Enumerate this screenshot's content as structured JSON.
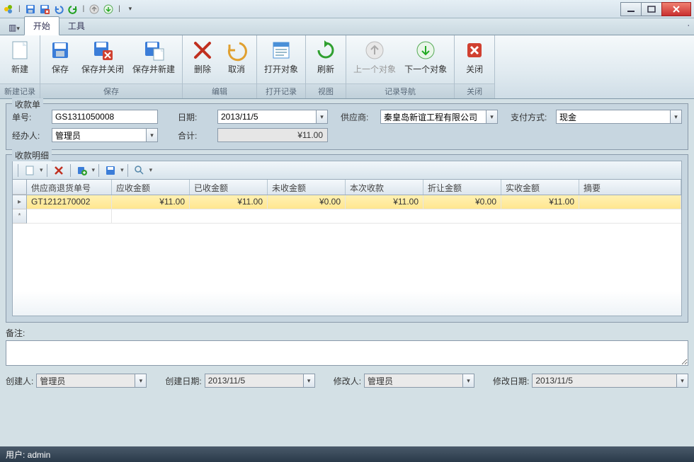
{
  "quick_access": {
    "customize": "▾"
  },
  "tabs": {
    "view_menu": "▾",
    "start": "开始",
    "tools": "工具"
  },
  "ribbon": {
    "new": {
      "label": "新建"
    },
    "save": {
      "label": "保存"
    },
    "save_close": {
      "label": "保存并关闭"
    },
    "save_new": {
      "label": "保存并新建"
    },
    "delete": {
      "label": "删除"
    },
    "cancel": {
      "label": "取消"
    },
    "open_obj": {
      "label": "打开对象"
    },
    "refresh": {
      "label": "刷新"
    },
    "prev_obj": {
      "label": "上一个对象"
    },
    "next_obj": {
      "label": "下一个对象"
    },
    "close": {
      "label": "关闭"
    },
    "groups": {
      "new_record": "新建记录",
      "save": "保存",
      "edit": "编辑",
      "open_record": "打开记录",
      "view": "视图",
      "nav": "记录导航",
      "close": "关闭"
    }
  },
  "form": {
    "section_title": "收款单",
    "order_no": {
      "label": "单号:",
      "value": "GS1311050008"
    },
    "date": {
      "label": "日期:",
      "value": "2013/11/5"
    },
    "supplier": {
      "label": "供应商:",
      "value": "秦皇岛新谊工程有限公司"
    },
    "pay_method": {
      "label": "支付方式:",
      "value": "现金"
    },
    "handler": {
      "label": "经办人:",
      "value": "管理员"
    },
    "total": {
      "label": "合计:",
      "value": "¥11.00"
    },
    "detail_title": "收款明细",
    "columns": {
      "return_no": "供应商退货单号",
      "receivable": "应收金额",
      "received": "已收金额",
      "unreceived": "未收金额",
      "this_receive": "本次收款",
      "discount": "折让金额",
      "actual": "实收金额",
      "summary": "摘要"
    },
    "rows": [
      {
        "return_no": "GT1212170002",
        "receivable": "¥11.00",
        "received": "¥11.00",
        "unreceived": "¥0.00",
        "this_receive": "¥11.00",
        "discount": "¥0.00",
        "actual": "¥11.00",
        "summary": ""
      }
    ],
    "remarks_label": "备注:",
    "remarks_value": "",
    "creator": {
      "label": "创建人:",
      "value": "管理员"
    },
    "create_date": {
      "label": "创建日期:",
      "value": "2013/11/5"
    },
    "modifier": {
      "label": "修改人:",
      "value": "管理员"
    },
    "modify_date": {
      "label": "修改日期:",
      "value": "2013/11/5"
    }
  },
  "statusbar": {
    "user_label": "用户: ",
    "user": "admin"
  }
}
